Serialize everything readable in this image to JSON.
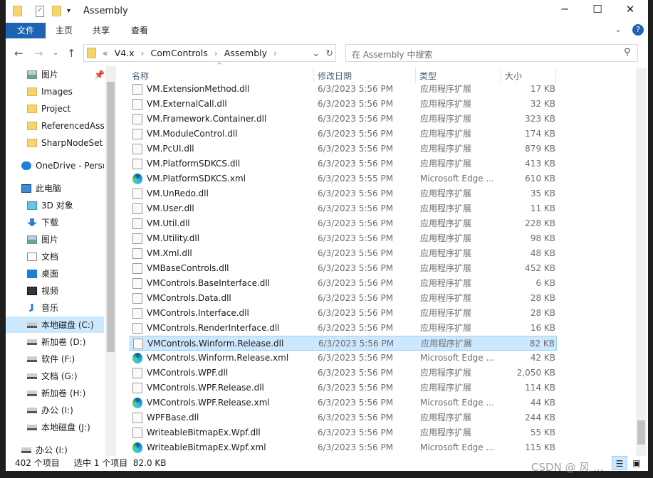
{
  "window": {
    "title": "Assembly",
    "controls": [
      "minimize",
      "maximize",
      "close"
    ]
  },
  "ribbon": {
    "tabs": [
      "文件",
      "主页",
      "共享",
      "查看"
    ]
  },
  "nav": {
    "breadcrumb": [
      "«",
      "V4.x",
      "ComControls",
      "Assembly"
    ],
    "search_placeholder": "在 Assembly 中搜索"
  },
  "sidebar": {
    "items": [
      {
        "label": "图片",
        "icon": "pictures-icon",
        "pinned": true
      },
      {
        "label": "Images",
        "icon": "folder-icon"
      },
      {
        "label": "Project",
        "icon": "folder-icon"
      },
      {
        "label": "ReferencedAss",
        "icon": "folder-icon"
      },
      {
        "label": "SharpNodeSet",
        "icon": "folder-icon"
      },
      {
        "label": "OneDrive - Perso",
        "icon": "cloud-icon"
      },
      {
        "label": "此电脑",
        "icon": "computer-icon"
      },
      {
        "label": "3D 对象",
        "icon": "cube-icon"
      },
      {
        "label": "下载",
        "icon": "download-icon"
      },
      {
        "label": "图片",
        "icon": "pictures-icon"
      },
      {
        "label": "文档",
        "icon": "document-icon"
      },
      {
        "label": "桌面",
        "icon": "desktop-icon"
      },
      {
        "label": "视频",
        "icon": "video-icon"
      },
      {
        "label": "音乐",
        "icon": "music-icon"
      },
      {
        "label": "本地磁盘 (C:)",
        "icon": "drive-icon",
        "selected": true
      },
      {
        "label": "新加卷 (D:)",
        "icon": "drive-icon"
      },
      {
        "label": "软件 (F:)",
        "icon": "drive-icon"
      },
      {
        "label": "文档 (G:)",
        "icon": "drive-icon"
      },
      {
        "label": "新加卷 (H:)",
        "icon": "drive-icon"
      },
      {
        "label": "办公 (I:)",
        "icon": "drive-icon"
      },
      {
        "label": "本地磁盘 (J:)",
        "icon": "drive-icon"
      },
      {
        "label": "办公 (I:)",
        "icon": "drive-icon"
      }
    ]
  },
  "columns": [
    "名称",
    "修改日期",
    "类型",
    "大小"
  ],
  "files": [
    {
      "name": "VM.ExtensionMethod.dll",
      "date": "6/3/2023 5:56 PM",
      "type": "应用程序扩展",
      "size": "17 KB",
      "icon": "dll"
    },
    {
      "name": "VM.ExternalCall.dll",
      "date": "6/3/2023 5:56 PM",
      "type": "应用程序扩展",
      "size": "32 KB",
      "icon": "dll"
    },
    {
      "name": "VM.Framework.Container.dll",
      "date": "6/3/2023 5:56 PM",
      "type": "应用程序扩展",
      "size": "323 KB",
      "icon": "dll"
    },
    {
      "name": "VM.ModuleControl.dll",
      "date": "6/3/2023 5:56 PM",
      "type": "应用程序扩展",
      "size": "174 KB",
      "icon": "dll"
    },
    {
      "name": "VM.PcUI.dll",
      "date": "6/3/2023 5:56 PM",
      "type": "应用程序扩展",
      "size": "879 KB",
      "icon": "dll"
    },
    {
      "name": "VM.PlatformSDKCS.dll",
      "date": "6/3/2023 5:56 PM",
      "type": "应用程序扩展",
      "size": "413 KB",
      "icon": "dll"
    },
    {
      "name": "VM.PlatformSDKCS.xml",
      "date": "6/3/2023 5:55 PM",
      "type": "Microsoft Edge ...",
      "size": "610 KB",
      "icon": "edge"
    },
    {
      "name": "VM.UnRedo.dll",
      "date": "6/3/2023 5:56 PM",
      "type": "应用程序扩展",
      "size": "35 KB",
      "icon": "dll"
    },
    {
      "name": "VM.User.dll",
      "date": "6/3/2023 5:56 PM",
      "type": "应用程序扩展",
      "size": "11 KB",
      "icon": "dll"
    },
    {
      "name": "VM.Util.dll",
      "date": "6/3/2023 5:56 PM",
      "type": "应用程序扩展",
      "size": "228 KB",
      "icon": "dll"
    },
    {
      "name": "VM.Utility.dll",
      "date": "6/3/2023 5:56 PM",
      "type": "应用程序扩展",
      "size": "98 KB",
      "icon": "dll"
    },
    {
      "name": "VM.Xml.dll",
      "date": "6/3/2023 5:56 PM",
      "type": "应用程序扩展",
      "size": "48 KB",
      "icon": "dll"
    },
    {
      "name": "VMBaseControls.dll",
      "date": "6/3/2023 5:56 PM",
      "type": "应用程序扩展",
      "size": "452 KB",
      "icon": "dll"
    },
    {
      "name": "VMControls.BaseInterface.dll",
      "date": "6/3/2023 5:56 PM",
      "type": "应用程序扩展",
      "size": "6 KB",
      "icon": "dll"
    },
    {
      "name": "VMControls.Data.dll",
      "date": "6/3/2023 5:56 PM",
      "type": "应用程序扩展",
      "size": "28 KB",
      "icon": "dll"
    },
    {
      "name": "VMControls.Interface.dll",
      "date": "6/3/2023 5:56 PM",
      "type": "应用程序扩展",
      "size": "28 KB",
      "icon": "dll"
    },
    {
      "name": "VMControls.RenderInterface.dll",
      "date": "6/3/2023 5:56 PM",
      "type": "应用程序扩展",
      "size": "16 KB",
      "icon": "dll"
    },
    {
      "name": "VMControls.Winform.Release.dll",
      "date": "6/3/2023 5:56 PM",
      "type": "应用程序扩展",
      "size": "82 KB",
      "icon": "dll",
      "selected": true
    },
    {
      "name": "VMControls.Winform.Release.xml",
      "date": "6/3/2023 5:56 PM",
      "type": "Microsoft Edge ...",
      "size": "42 KB",
      "icon": "edge"
    },
    {
      "name": "VMControls.WPF.dll",
      "date": "6/3/2023 5:56 PM",
      "type": "应用程序扩展",
      "size": "2,050 KB",
      "icon": "dll"
    },
    {
      "name": "VMControls.WPF.Release.dll",
      "date": "6/3/2023 5:56 PM",
      "type": "应用程序扩展",
      "size": "114 KB",
      "icon": "dll"
    },
    {
      "name": "VMControls.WPF.Release.xml",
      "date": "6/3/2023 5:56 PM",
      "type": "Microsoft Edge ...",
      "size": "44 KB",
      "icon": "edge"
    },
    {
      "name": "WPFBase.dll",
      "date": "6/3/2023 5:56 PM",
      "type": "应用程序扩展",
      "size": "244 KB",
      "icon": "dll"
    },
    {
      "name": "WriteableBitmapEx.Wpf.dll",
      "date": "6/3/2023 5:56 PM",
      "type": "应用程序扩展",
      "size": "55 KB",
      "icon": "dll"
    },
    {
      "name": "WriteableBitmapEx.Wpf.xml",
      "date": "6/3/2023 5:56 PM",
      "type": "Microsoft Edge ...",
      "size": "115 KB",
      "icon": "edge"
    }
  ],
  "status": {
    "count": "402 个项目",
    "selection": "选中 1 个项目  82.0 KB"
  },
  "watermark": "CSDN @ 风 ...",
  "colors": {
    "accent": "#1f64b4",
    "selection": "#cce8ff"
  }
}
